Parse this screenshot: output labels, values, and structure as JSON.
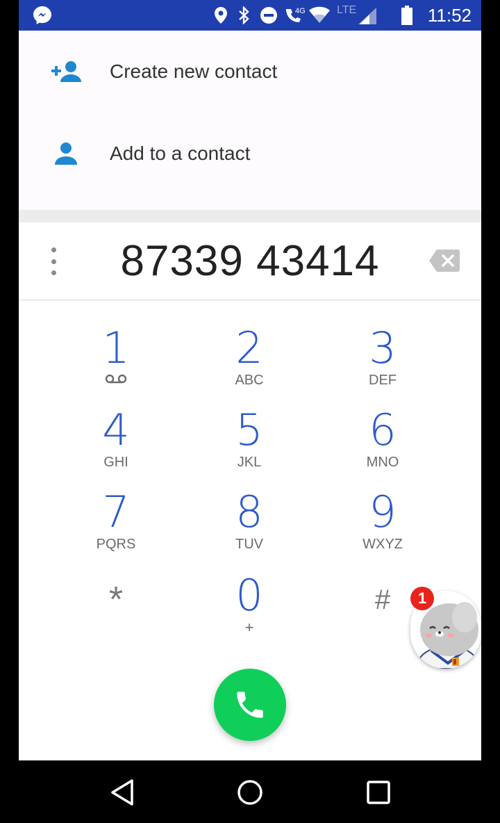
{
  "status_bar": {
    "time": "11:52",
    "network_label": "4G",
    "lte_label": "LTE",
    "icons": [
      "messenger-icon",
      "location-icon",
      "bluetooth-icon",
      "do-not-disturb-icon",
      "wifi-calling-icon",
      "wifi-icon",
      "cell-signal-icon",
      "battery-icon"
    ],
    "background_color": "#1f3fae"
  },
  "suggestions": [
    {
      "label": "Create new contact",
      "icon": "add-person-icon"
    },
    {
      "label": "Add to a contact",
      "icon": "person-icon"
    }
  ],
  "dialer": {
    "number": "87339 43414",
    "keys": [
      {
        "digit": "1",
        "letters": ""
      },
      {
        "digit": "2",
        "letters": "ABC"
      },
      {
        "digit": "3",
        "letters": "DEF"
      },
      {
        "digit": "4",
        "letters": "GHI"
      },
      {
        "digit": "5",
        "letters": "JKL"
      },
      {
        "digit": "6",
        "letters": "MNO"
      },
      {
        "digit": "7",
        "letters": "PQRS"
      },
      {
        "digit": "8",
        "letters": "TUV"
      },
      {
        "digit": "9",
        "letters": "WXYZ"
      },
      {
        "digit": "*",
        "letters": ""
      },
      {
        "digit": "0",
        "letters": "+"
      },
      {
        "digit": "#",
        "letters": ""
      }
    ],
    "digit_color": "#2e5bc9",
    "call_button_color": "#0fcf5a"
  },
  "chathead": {
    "badge_count": "1"
  },
  "nav_bar": {
    "icons": [
      "back-icon",
      "home-icon",
      "recents-icon"
    ]
  }
}
